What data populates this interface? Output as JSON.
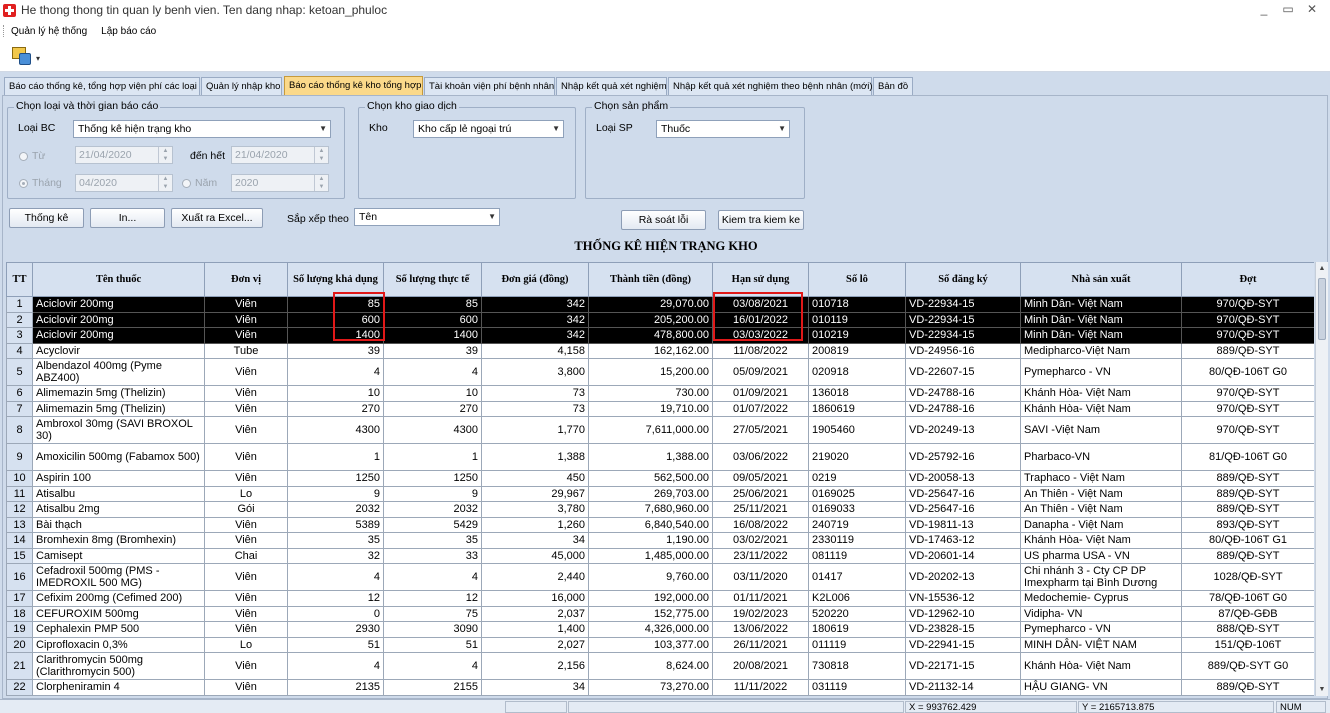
{
  "window": {
    "title": "He thong thong tin quan ly benh vien. Ten dang nhap: ketoan_phuloc",
    "minimize": "_",
    "restore": "▭",
    "close": "✕"
  },
  "menu": {
    "items": [
      "Quản lý hệ thống",
      "Lập báo cáo"
    ]
  },
  "toolbar": {
    "dropdown": "▾"
  },
  "tabs": [
    {
      "label": "Báo cáo thống kê, tổng hợp viện phí các loại",
      "active": false
    },
    {
      "label": "Quản lý nhập kho",
      "active": false
    },
    {
      "label": "Báo cáo thống kê kho tổng hợp",
      "active": true
    },
    {
      "label": "Tài khoản viện phí bệnh nhân",
      "active": false
    },
    {
      "label": "Nhập kết quả xét nghiệm",
      "active": false
    },
    {
      "label": "Nhập kết quả xét nghiệm theo bệnh nhân (mới)",
      "active": false
    },
    {
      "label": "Bản đồ",
      "active": false
    }
  ],
  "filters": {
    "report_group_label": "Chọn loại và thời gian báo cáo",
    "report_type_label": "Loại BC",
    "report_type_value": "Thống kê hiện trạng kho",
    "from_label": "Từ",
    "from_value": "21/04/2020",
    "to_label": "đến hết",
    "to_value": "21/04/2020",
    "month_label": "Tháng",
    "month_value": "04/2020",
    "year_label": "Năm",
    "year_value": "2020",
    "warehouse_group_label": "Chọn kho giao dịch",
    "warehouse_label": "Kho",
    "warehouse_value": "Kho cấp lẻ ngoại trú",
    "product_group_label": "Chọn sản phẩm",
    "product_type_label": "Loại SP",
    "product_type_value": "Thuốc"
  },
  "actions": {
    "stats": "Thống kê",
    "print": "In...",
    "excel": "Xuất ra Excel...",
    "sort_label": "Sắp xếp theo",
    "sort_value": "Tên",
    "check_errors": "Rà soát lỗi",
    "check_inventory": "Kiem tra kiem ke"
  },
  "report_title": "THỐNG KÊ HIỆN TRẠNG KHO",
  "table": {
    "columns": [
      "TT",
      "Tên thuốc",
      "Đơn vị",
      "Số lượng khả dụng",
      "Số lượng thực tế",
      "Đơn giá (đồng)",
      "Thành tiền (đồng)",
      "Hạn sử dụng",
      "Số lô",
      "Số đăng ký",
      "Nhà sản xuất",
      "Đợt"
    ],
    "rows": [
      [
        "1",
        "Aciclovir 200mg",
        "Viên",
        "85",
        "85",
        "342",
        "29,070.00",
        "03/08/2021",
        "010718",
        "VD-22934-15",
        "Minh Dân- Việt Nam",
        "970/QĐ-SYT"
      ],
      [
        "2",
        "Aciclovir 200mg",
        "Viên",
        "600",
        "600",
        "342",
        "205,200.00",
        "16/01/2022",
        "010119",
        "VD-22934-15",
        "Minh Dân- Việt Nam",
        "970/QĐ-SYT"
      ],
      [
        "3",
        "Aciclovir 200mg",
        "Viên",
        "1400",
        "1400",
        "342",
        "478,800.00",
        "03/03/2022",
        "010219",
        "VD-22934-15",
        "Minh Dân- Việt Nam",
        "970/QĐ-SYT"
      ],
      [
        "4",
        "Acyclovir",
        "Tube",
        "39",
        "39",
        "4,158",
        "162,162.00",
        "11/08/2022",
        "200819",
        "VD-24956-16",
        "Medipharco-Việt Nam",
        "889/QĐ-SYT"
      ],
      [
        "5",
        "Albendazol 400mg (Pyme ABZ400)",
        "Viên",
        "4",
        "4",
        "3,800",
        "15,200.00",
        "05/09/2021",
        "020918",
        "VD-22607-15",
        "Pymepharco - VN",
        "80/QĐ-106T G0"
      ],
      [
        "6",
        "Alimemazin 5mg (Thelizin)",
        "Viên",
        "10",
        "10",
        "73",
        "730.00",
        "01/09/2021",
        "136018",
        "VD-24788-16",
        "Khánh Hòa- Việt Nam",
        "970/QĐ-SYT"
      ],
      [
        "7",
        "Alimemazin 5mg (Thelizin)",
        "Viên",
        "270",
        "270",
        "73",
        "19,710.00",
        "01/07/2022",
        "1860619",
        "VD-24788-16",
        "Khánh Hòa- Việt Nam",
        "970/QĐ-SYT"
      ],
      [
        "8",
        "Ambroxol 30mg (SAVI BROXOL 30)",
        "Viên",
        "4300",
        "4300",
        "1,770",
        "7,611,000.00",
        "27/05/2021",
        "1905460",
        "VD-20249-13",
        "SAVI -Việt Nam",
        "970/QĐ-SYT"
      ],
      [
        "9",
        "Amoxicilin 500mg (Fabamox 500)",
        "Viên",
        "1",
        "1",
        "1,388",
        "1,388.00",
        "03/06/2022",
        "219020",
        "VD-25792-16",
        "Pharbaco-VN",
        "81/QĐ-106T G0"
      ],
      [
        "10",
        "Aspirin 100",
        "Viên",
        "1250",
        "1250",
        "450",
        "562,500.00",
        "09/05/2021",
        "0219",
        "VD-20058-13",
        "Traphaco - Việt Nam",
        "889/QĐ-SYT"
      ],
      [
        "11",
        "Atisalbu",
        "Lo",
        "9",
        "9",
        "29,967",
        "269,703.00",
        "25/06/2021",
        "0169025",
        "VD-25647-16",
        "An Thiên - Việt Nam",
        "889/QĐ-SYT"
      ],
      [
        "12",
        "Atisalbu 2mg",
        "Gói",
        "2032",
        "2032",
        "3,780",
        "7,680,960.00",
        "25/11/2021",
        "0169033",
        "VD-25647-16",
        "An Thiên - Việt Nam",
        "889/QĐ-SYT"
      ],
      [
        "13",
        "Bài thạch",
        "Viên",
        "5389",
        "5429",
        "1,260",
        "6,840,540.00",
        "16/08/2022",
        "240719",
        "VD-19811-13",
        "Danapha - Việt Nam",
        "893/QĐ-SYT"
      ],
      [
        "14",
        "Bromhexin 8mg (Bromhexin)",
        "Viên",
        "35",
        "35",
        "34",
        "1,190.00",
        "03/02/2021",
        "2330119",
        "VD-17463-12",
        "Khánh Hòa- Việt Nam",
        "80/QĐ-106T G1"
      ],
      [
        "15",
        "Camisept",
        "Chai",
        "32",
        "33",
        "45,000",
        "1,485,000.00",
        "23/11/2022",
        "081119",
        "VD-20601-14",
        "US pharma USA - VN",
        "889/QĐ-SYT"
      ],
      [
        "16",
        "Cefadroxil 500mg (PMS - IMEDROXIL 500 MG)",
        "Viên",
        "4",
        "4",
        "2,440",
        "9,760.00",
        "03/11/2020",
        "01417",
        "VD-20202-13",
        "Chi nhánh 3 - Cty CP DP Imexpharm tại Bình Dương",
        "1028/QĐ-SYT"
      ],
      [
        "17",
        "Cefixim 200mg (Cefimed 200)",
        "Viên",
        "12",
        "12",
        "16,000",
        "192,000.00",
        "01/11/2021",
        "K2L006",
        "VN-15536-12",
        "Medochemie- Cyprus",
        "78/QĐ-106T G0"
      ],
      [
        "18",
        "CEFUROXIM 500mg",
        "Viên",
        "0",
        "75",
        "2,037",
        "152,775.00",
        "19/02/2023",
        "520220",
        "VD-12962-10",
        "Vidipha- VN",
        "87/QĐ-GĐB"
      ],
      [
        "19",
        "Cephalexin PMP 500",
        "Viên",
        "2930",
        "3090",
        "1,400",
        "4,326,000.00",
        "13/06/2022",
        "180619",
        "VD-23828-15",
        "Pymepharco - VN",
        "888/QĐ-SYT"
      ],
      [
        "20",
        "Ciprofloxacin 0,3%",
        "Lo",
        "51",
        "51",
        "2,027",
        "103,377.00",
        "26/11/2021",
        "011119",
        "VD-22941-15",
        "MINH DÂN- VIỆT NAM",
        "151/QĐ-106T"
      ],
      [
        "21",
        "Clarithromycin 500mg (Clarithromycin 500)",
        "Viên",
        "4",
        "4",
        "2,156",
        "8,624.00",
        "20/08/2021",
        "730818",
        "VD-22171-15",
        "Khánh Hòa- Việt Nam",
        "889/QĐ-SYT G0"
      ],
      [
        "22",
        "Clorpheniramin 4",
        "Viên",
        "2135",
        "2155",
        "34",
        "73,270.00",
        "11/11/2022",
        "031119",
        "VD-21132-14",
        "HẬU GIANG- VN",
        "889/QĐ-SYT"
      ]
    ]
  },
  "status": {
    "x": "X = 993762.429",
    "y": "Y = 2165713.875",
    "num": "NUM"
  }
}
